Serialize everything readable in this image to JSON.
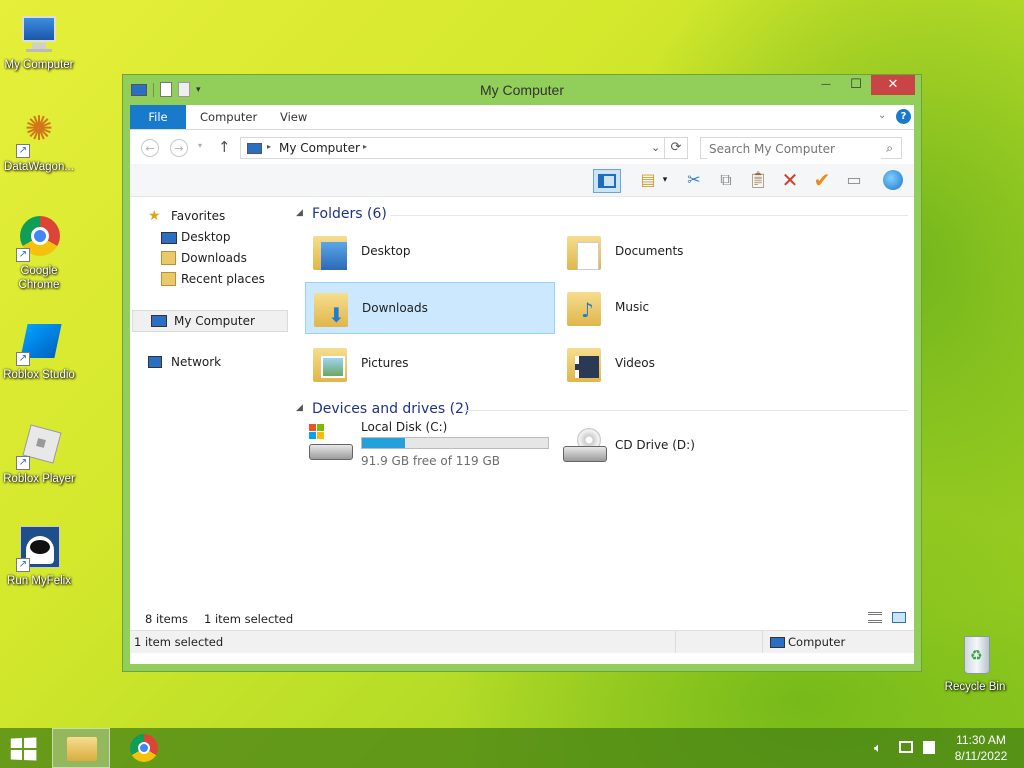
{
  "colors": {
    "accent": "#1979ca",
    "window_frame": "#92cf5a",
    "selection": "#cce8ff",
    "progress": "#26a0da",
    "close": "#c94444"
  },
  "desktop": {
    "icons": [
      {
        "label": "My Computer",
        "icon": "computer-icon"
      },
      {
        "label": "DataWagon...",
        "icon": "datawagon-icon"
      },
      {
        "label": "Google Chrome",
        "icon": "chrome-icon"
      },
      {
        "label": "Roblox Studio",
        "icon": "roblox-studio-icon"
      },
      {
        "label": "Roblox Player",
        "icon": "roblox-player-icon"
      },
      {
        "label": "Run MyFelix",
        "icon": "myfelix-icon"
      }
    ],
    "recycle_bin": "Recycle Bin"
  },
  "window": {
    "title": "My Computer",
    "controls": {
      "minimize": "—",
      "maximize": "☐",
      "close": "✕"
    },
    "ribbon_tabs": [
      "File",
      "Computer",
      "View"
    ],
    "address": {
      "location": "My Computer"
    },
    "search": {
      "placeholder": "Search My Computer"
    },
    "nav": {
      "favorites": "Favorites",
      "favorites_items": [
        "Desktop",
        "Downloads",
        "Recent places"
      ],
      "computer": "My Computer",
      "network": "Network"
    },
    "folders_header": "Folders (6)",
    "folders": [
      {
        "name": "Desktop",
        "selected": false
      },
      {
        "name": "Documents",
        "selected": false
      },
      {
        "name": "Downloads",
        "selected": true
      },
      {
        "name": "Music",
        "selected": false
      },
      {
        "name": "Pictures",
        "selected": false
      },
      {
        "name": "Videos",
        "selected": false
      }
    ],
    "devices_header": "Devices and drives (2)",
    "drives": [
      {
        "name": "Local Disk (C:)",
        "free": "91.9 GB free of 119 GB",
        "used_fraction": 0.23
      },
      {
        "name": "CD Drive (D:)"
      }
    ],
    "status": {
      "items": "8 items",
      "selected": "1 item selected",
      "bottom_left": "1 item selected",
      "bottom_right": "Computer"
    }
  },
  "taskbar": {
    "time": "11:30 AM",
    "date": "8/11/2022"
  }
}
